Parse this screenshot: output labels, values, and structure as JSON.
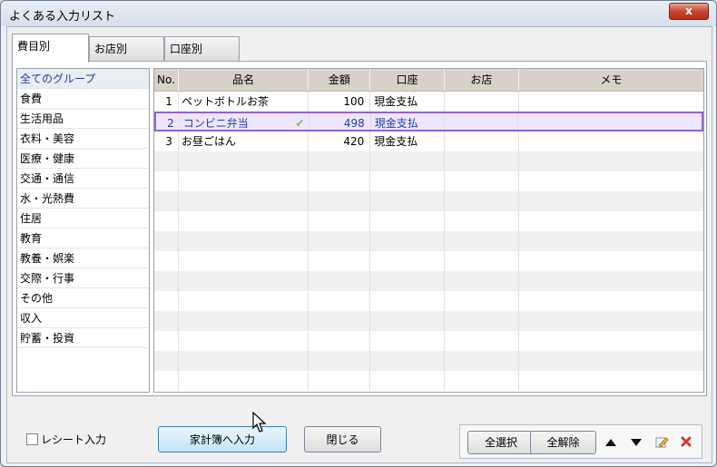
{
  "window": {
    "title": "よくある入力リスト",
    "close_label": "x"
  },
  "tabs": [
    {
      "label": "費目別",
      "active": true
    },
    {
      "label": "お店別",
      "active": false
    },
    {
      "label": "口座別",
      "active": false
    }
  ],
  "groups": [
    "全てのグループ",
    "食費",
    "生活用品",
    "衣料・美容",
    "医療・健康",
    "交通・通信",
    "水・光熱費",
    "住居",
    "教育",
    "教養・娯楽",
    "交際・行事",
    "その他",
    "収入",
    "貯蓄・投資"
  ],
  "table": {
    "headers": [
      "No.",
      "品名",
      "金額",
      "口座",
      "お店",
      "メモ"
    ],
    "rows": [
      {
        "no": "1",
        "name": "ペットボトルお茶",
        "amount": "100",
        "account": "現金支払",
        "shop": "",
        "memo": ""
      },
      {
        "no": "2",
        "name": "コンビニ弁当",
        "amount": "498",
        "account": "現金支払",
        "shop": "",
        "memo": ""
      },
      {
        "no": "3",
        "name": "お昼ごはん",
        "amount": "420",
        "account": "現金支払",
        "shop": "",
        "memo": ""
      }
    ]
  },
  "footer": {
    "receipt_label": "レシート入力",
    "to_book_label": "家計簿へ入力",
    "close_label": "閉じる",
    "select_all_label": "全選択",
    "deselect_all_label": "全解除"
  },
  "colors": {
    "selection_border": "#8d68c8",
    "selection_fill": "#eee5ff",
    "header": "#d7d1c7"
  }
}
